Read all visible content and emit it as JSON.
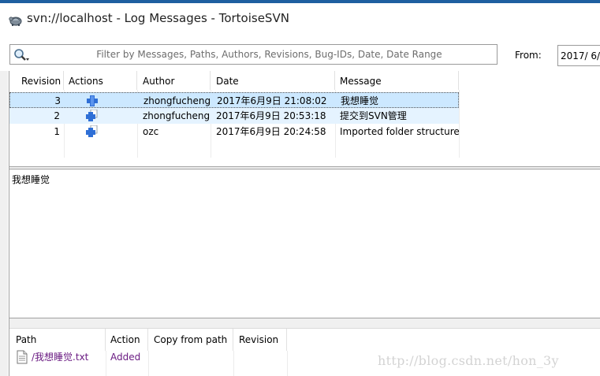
{
  "window": {
    "title": "svn://localhost - Log Messages - TortoiseSVN",
    "accent_color": "#1e5fa0"
  },
  "filter": {
    "placeholder": "Filter by Messages, Paths, Authors, Revisions, Bug-IDs, Date, Date Range",
    "icon": "search-icon"
  },
  "date_range": {
    "from_label": "From:",
    "from_value": "2017/  6/"
  },
  "log": {
    "columns": [
      "Revision",
      "Actions",
      "Author",
      "Date",
      "Message"
    ],
    "rows": [
      {
        "revision": "3",
        "action_icon": "added-icon",
        "author": "zhongfucheng",
        "date": "2017年6月9日 21:08:02",
        "message": "我想睡觉",
        "state": "selected"
      },
      {
        "revision": "2",
        "action_icon": "modified-icon",
        "author": "zhongfucheng",
        "date": "2017年6月9日 20:53:18",
        "message": "提交到SVN管理",
        "state": "hot"
      },
      {
        "revision": "1",
        "action_icon": "modified-icon",
        "author": "ozc",
        "date": "2017年6月9日 20:24:58",
        "message": "Imported folder structure",
        "state": "normal"
      }
    ]
  },
  "message_pane": {
    "text": "我想睡觉"
  },
  "paths": {
    "columns": [
      "Path",
      "Action",
      "Copy from path",
      "Revision"
    ],
    "rows": [
      {
        "path": "/我想睡觉.txt",
        "action": "Added",
        "copy_from": "",
        "revision": ""
      }
    ],
    "changed_color": "#6a1b82"
  },
  "watermark": "http://blog.csdn.net/hon_3y"
}
